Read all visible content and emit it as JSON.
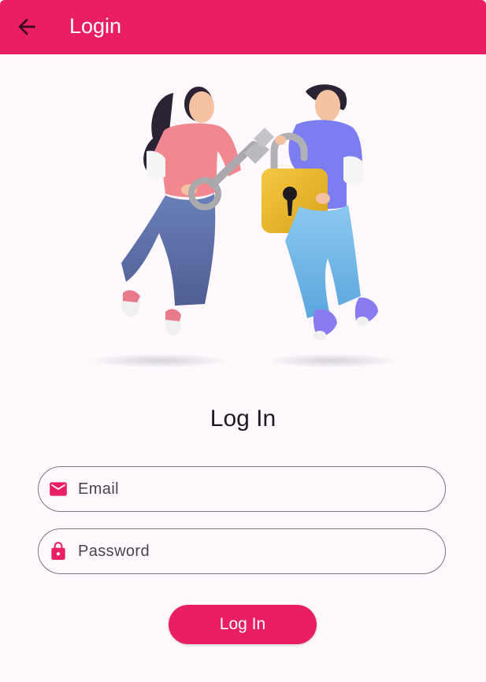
{
  "app_bar": {
    "title": "Login",
    "back_icon": "arrow-back-icon",
    "color": "#e91e63"
  },
  "hero": {
    "illustration": "two-people-key-padlock-illustration"
  },
  "form": {
    "heading": "Log In",
    "email": {
      "placeholder": "Email",
      "icon": "mail-icon",
      "value": ""
    },
    "password": {
      "placeholder": "Password",
      "icon": "lock-icon",
      "value": ""
    },
    "submit_label": "Log In"
  },
  "colors": {
    "accent": "#e91e63",
    "background": "#fff8fd",
    "text": "#1d1b20",
    "outline": "#7a757f"
  }
}
